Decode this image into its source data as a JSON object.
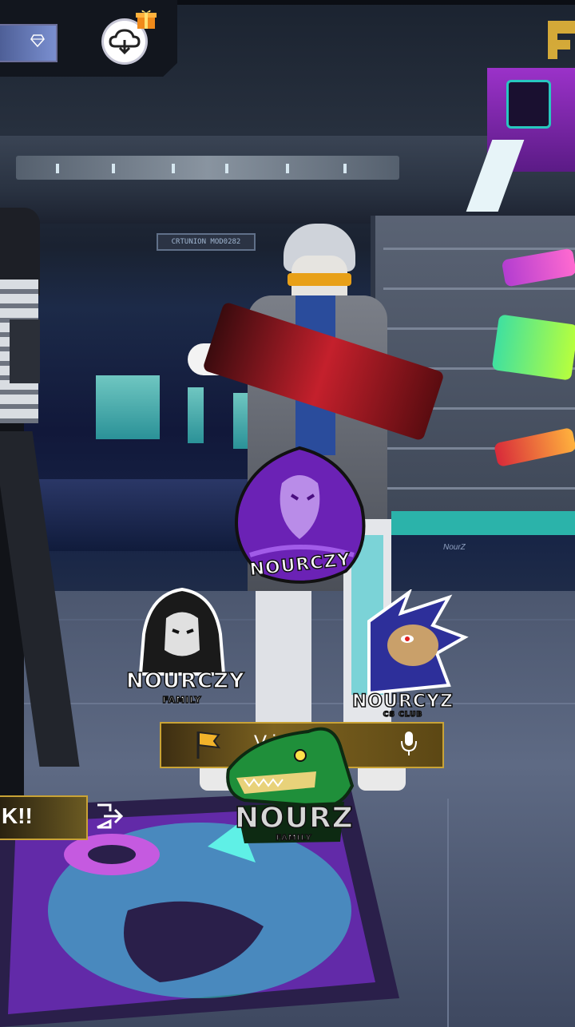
{
  "window": {
    "title": "Lobby"
  },
  "hud": {
    "diamond_icon": "diamond-icon",
    "cloud_icon": "cloud-download-icon",
    "gift_icon": "gift-icon",
    "backdrop_sign": "CRTUNION MOD0282",
    "floor_text": "NourZ"
  },
  "logos": [
    {
      "name": "NOURCZY",
      "sub": "",
      "color": "#8a3be3"
    },
    {
      "name": "NOURCZY",
      "sub": "FAMILY",
      "color": "#111111"
    },
    {
      "name": "NOURCYZ",
      "sub": "CS CLUB",
      "color": "#3b3fb5"
    },
    {
      "name": "NOURZ",
      "sub": "FAMILY",
      "color": "#1f8f3a"
    }
  ],
  "voice": {
    "label": "Voix activée",
    "visible_text": "V      icée",
    "mic_icon": "microphone-icon"
  },
  "status": {
    "label": "K!!"
  },
  "exit_icon": "exit-icon",
  "colors": {
    "gold": "#c9a336",
    "purple": "#9b32c9",
    "teal": "#2bb3aa"
  }
}
